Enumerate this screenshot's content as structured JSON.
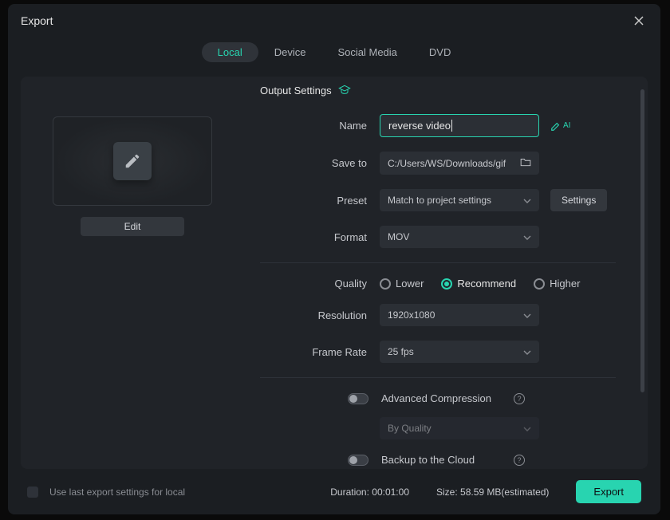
{
  "title": "Export",
  "tabs": [
    "Local",
    "Device",
    "Social Media",
    "DVD"
  ],
  "active_tab": 0,
  "preview": {
    "edit_label": "Edit"
  },
  "section_title": "Output Settings",
  "fields": {
    "name_label": "Name",
    "name_value": "reverse video",
    "saveto_label": "Save to",
    "saveto_value": "C:/Users/WS/Downloads/gif",
    "preset_label": "Preset",
    "preset_value": "Match to project settings",
    "settings_label": "Settings",
    "format_label": "Format",
    "format_value": "MOV",
    "quality_label": "Quality",
    "quality_options": [
      "Lower",
      "Recommend",
      "Higher"
    ],
    "quality_selected": 1,
    "resolution_label": "Resolution",
    "resolution_value": "1920x1080",
    "framerate_label": "Frame Rate",
    "framerate_value": "25 fps",
    "advcomp_label": "Advanced Compression",
    "advcomp_mode": "By Quality",
    "backup_label": "Backup to the Cloud"
  },
  "footer": {
    "use_last_label": "Use last export settings for local",
    "duration_label": "Duration:",
    "duration_value": "00:01:00",
    "size_label": "Size:",
    "size_value": "58.59 MB(estimated)",
    "export_label": "Export"
  }
}
